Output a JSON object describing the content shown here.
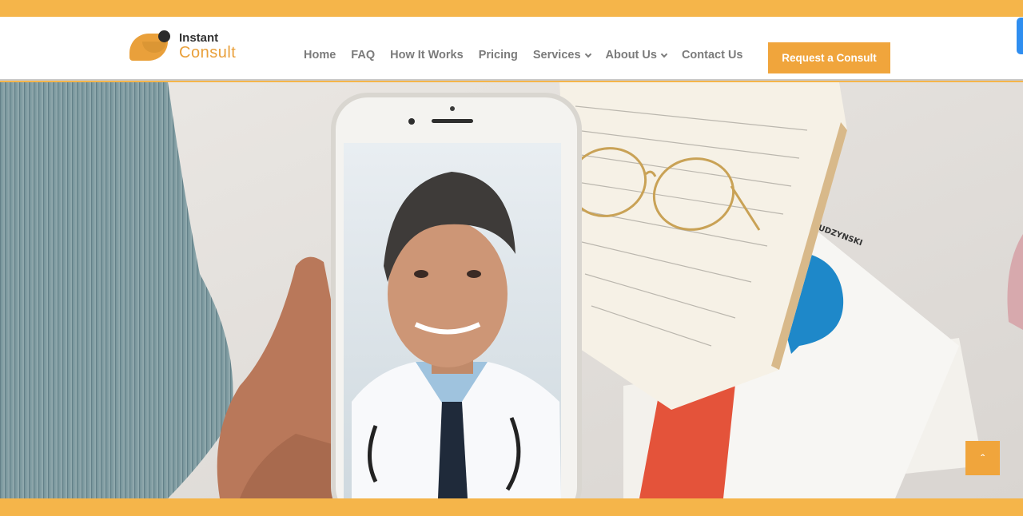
{
  "brand": {
    "name_line1": "Instant",
    "name_line2": "Consult",
    "accent_color": "#f0a53c",
    "band_color": "#f5b54a",
    "logo_icon": "leaf-dot-logo-icon"
  },
  "nav": {
    "items": [
      {
        "label": "Home",
        "has_dropdown": false
      },
      {
        "label": "FAQ",
        "has_dropdown": false
      },
      {
        "label": "How It Works",
        "has_dropdown": false
      },
      {
        "label": "Pricing",
        "has_dropdown": false
      },
      {
        "label": "Services",
        "has_dropdown": true
      },
      {
        "label": "About Us",
        "has_dropdown": true
      },
      {
        "label": "Contact Us",
        "has_dropdown": false
      }
    ],
    "dropdown_icon": "chevron-down-icon"
  },
  "cta": {
    "label": "Request a Consult"
  },
  "hero": {
    "image_description_icon": "doctor-on-phone-hero-image",
    "book_text": "H BUDZYNSKI"
  },
  "scroll_top": {
    "glyph": "ˆ",
    "icon": "chevron-up-icon"
  }
}
